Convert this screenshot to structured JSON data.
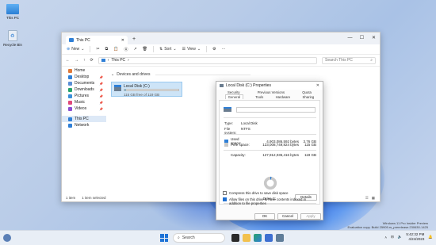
{
  "desktop": {
    "icons": [
      {
        "label": "This PC",
        "icon": "monitor-icon"
      },
      {
        "label": "Recycle Bin",
        "icon": "recycle-bin-icon"
      }
    ]
  },
  "explorer": {
    "tab_title": "This PC",
    "toolbar": {
      "new_label": "New",
      "sort_label": "Sort",
      "view_label": "View",
      "more_label": "···"
    },
    "address": "This PC",
    "search_placeholder": "Search This PC",
    "nav": [
      {
        "label": "Home",
        "icon": "home-icon",
        "color": "#e07a3a",
        "pinned": false
      },
      {
        "label": "Desktop",
        "icon": "desktop-icon",
        "color": "#2f7fd6",
        "pinned": true
      },
      {
        "label": "Documents",
        "icon": "documents-icon",
        "color": "#5b8fd6",
        "pinned": true
      },
      {
        "label": "Downloads",
        "icon": "downloads-icon",
        "color": "#27a36b",
        "pinned": true
      },
      {
        "label": "Pictures",
        "icon": "pictures-icon",
        "color": "#3a8fd9",
        "pinned": true
      },
      {
        "label": "Music",
        "icon": "music-icon",
        "color": "#e0497a",
        "pinned": true
      },
      {
        "label": "Videos",
        "icon": "videos-icon",
        "color": "#8b4fd1",
        "pinned": true
      },
      {
        "label": "This PC",
        "icon": "this-pc-icon",
        "color": "#2f7fd6",
        "pinned": false
      },
      {
        "label": "Network",
        "icon": "network-icon",
        "color": "#2f7fd6",
        "pinned": false
      }
    ],
    "group_header": "Devices and drives",
    "drive": {
      "name": "Local Disk (C:)",
      "free_text": "115 GB free of 119 GB",
      "used_fraction": 0.03
    },
    "status": {
      "items": "1 item",
      "selected": "1 item selected"
    }
  },
  "properties": {
    "title": "Local Disk (C:) Properties",
    "tabs_row1": [
      "Security",
      "Previous Versions",
      "Quota"
    ],
    "tabs_row2": [
      "General",
      "Tools",
      "Hardware",
      "Sharing"
    ],
    "type_label": "Type:",
    "type_value": "Local Disk",
    "fs_label": "File system:",
    "fs_value": "NTFS",
    "used": {
      "label": "Used space:",
      "bytes": "4,903,086,592 bytes",
      "gb": "3.76 GB",
      "color": "#2f7fd6"
    },
    "free": {
      "label": "Free space:",
      "bytes": "123,008,749,824 bytes",
      "gb": "115 GB",
      "color": "#c8c8c8"
    },
    "capacity": {
      "label": "Capacity:",
      "bytes": "127,912,036,416 bytes",
      "gb": "119 GB"
    },
    "used_fraction": 0.03,
    "drive_label": "Drive C:",
    "cleanup_button": "Details",
    "compress_label": "Compress this drive to save disk space",
    "compress_checked": false,
    "index_label": "Allow files on this drive to have contents indexed in addition to file properties",
    "index_checked": true,
    "ok": "OK",
    "cancel": "Cancel",
    "apply": "Apply"
  },
  "watermark": {
    "line1": "Windows 11 Pro Insider Preview",
    "line2": "Evaluation copy. Build 25905.rs_prerelease.230630-1425"
  },
  "taskbar": {
    "search_label": "Search",
    "time": "5:42:32 PM",
    "date": "4/24/2023"
  }
}
